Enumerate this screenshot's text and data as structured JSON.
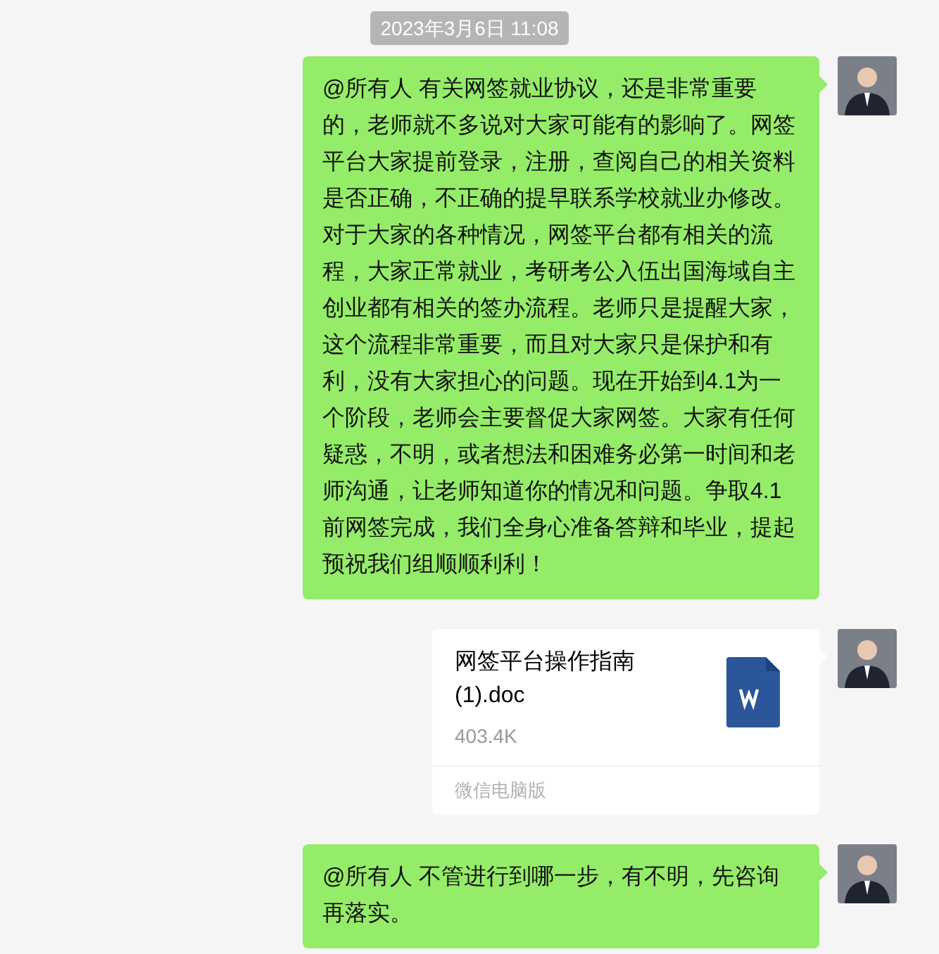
{
  "timestamp": "2023年3月6日 11:08",
  "messages": [
    {
      "kind": "text",
      "text": "@所有人 有关网签就业协议，还是非常重要的，老师就不多说对大家可能有的影响了。网签平台大家提前登录，注册，查阅自己的相关资料是否正确，不正确的提早联系学校就业办修改。对于大家的各种情况，网签平台都有相关的流程，大家正常就业，考研考公入伍出国海域自主创业都有相关的签办流程。老师只是提醒大家，这个流程非常重要，而且对大家只是保护和有利，没有大家担心的问题。现在开始到4.1为一个阶段，老师会主要督促大家网签。大家有任何疑惑，不明，或者想法和困难务必第一时间和老师沟通，让老师知道你的情况和问题。争取4.1前网签完成，我们全身心准备答辩和毕业，提起预祝我们组顺顺利利！"
    },
    {
      "kind": "file",
      "file_name": "网签平台操作指南(1).doc",
      "size": "403.4K",
      "source": "微信电脑版"
    },
    {
      "kind": "text",
      "text": "@所有人 不管进行到哪一步，有不明，先咨询再落实。"
    }
  ]
}
